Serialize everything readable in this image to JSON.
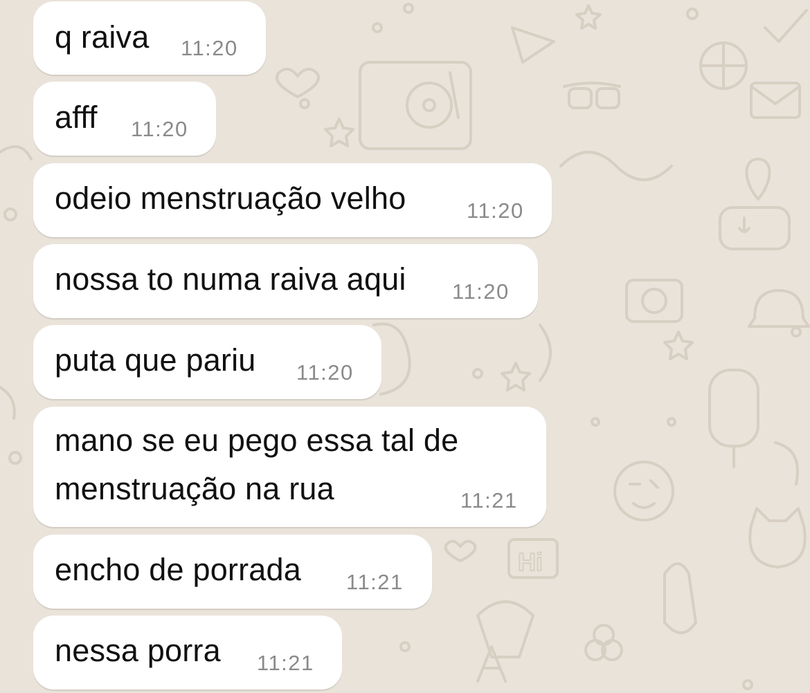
{
  "theme": {
    "wallpaper_color": "#e9e3da",
    "doodle_color": "#d7cfc2",
    "bubble_color": "#ffffff",
    "text_color": "#111111",
    "time_color": "#8a8a8a"
  },
  "messages": [
    {
      "lines": [
        "q raiva"
      ],
      "time": "11:20"
    },
    {
      "lines": [
        "afff"
      ],
      "time": "11:20"
    },
    {
      "lines": [
        "odeio menstruação velho"
      ],
      "time": "11:20"
    },
    {
      "lines": [
        "nossa to numa raiva aqui"
      ],
      "time": "11:20"
    },
    {
      "lines": [
        "puta que pariu"
      ],
      "time": "11:20"
    },
    {
      "lines": [
        "mano se eu pego essa tal de",
        "menstruação na rua"
      ],
      "time": "11:21"
    },
    {
      "lines": [
        "encho de porrada"
      ],
      "time": "11:21"
    },
    {
      "lines": [
        "nessa porra"
      ],
      "time": "11:21"
    }
  ]
}
